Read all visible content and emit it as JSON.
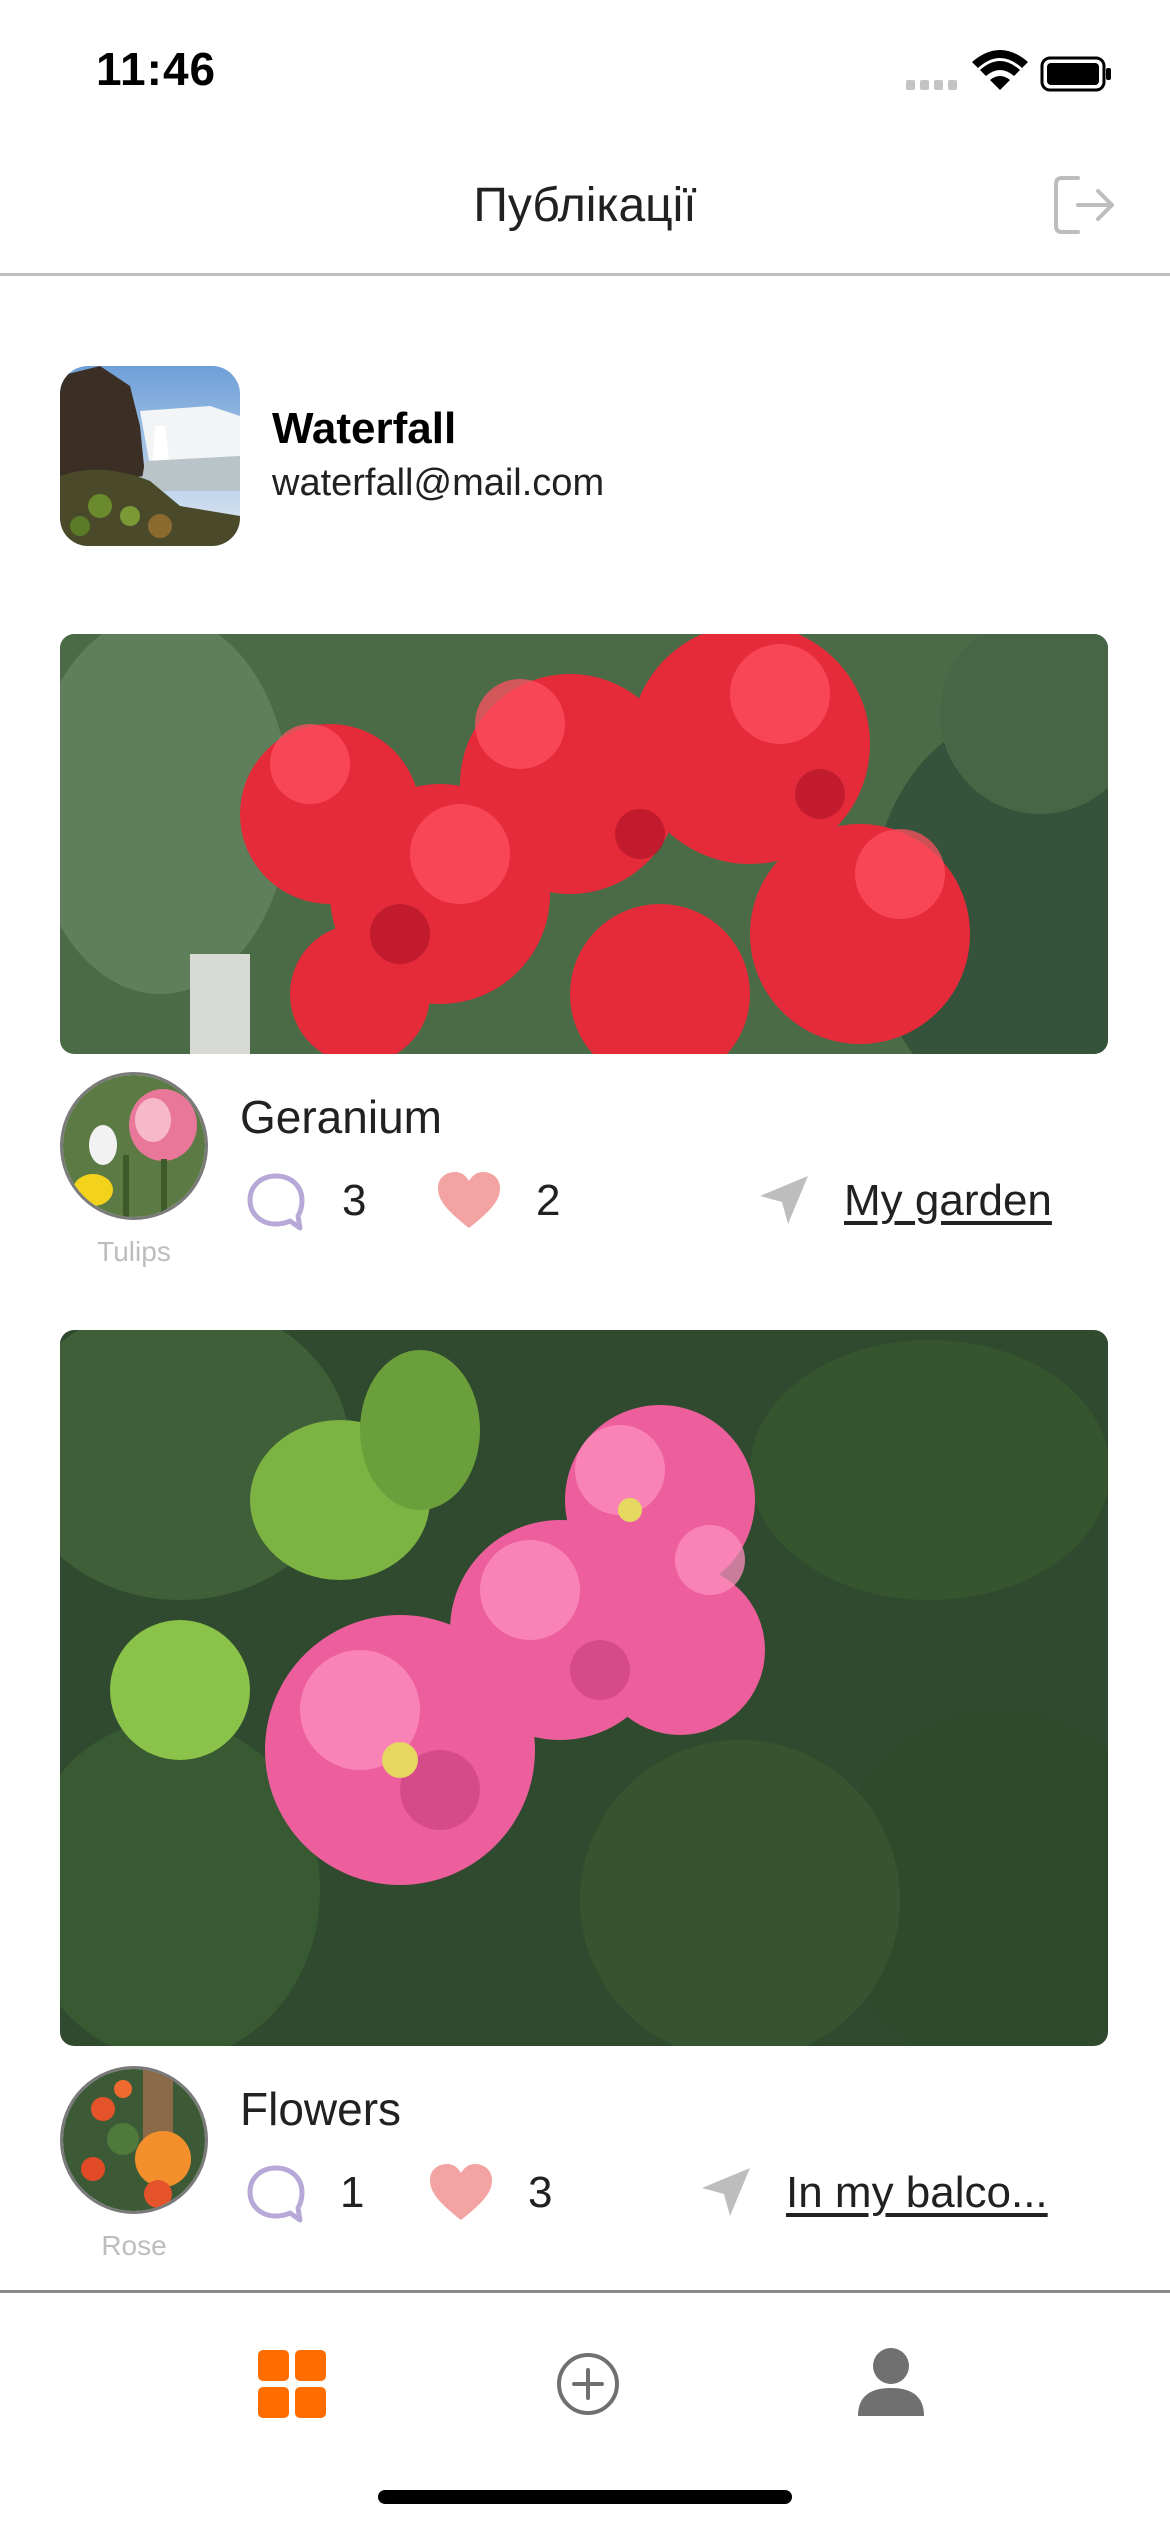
{
  "status_bar": {
    "time": "11:46"
  },
  "header": {
    "title": "Публікації"
  },
  "profile": {
    "name": "Waterfall",
    "email": "waterfall@mail.com"
  },
  "posts": [
    {
      "title": "Geranium",
      "thumb_label": "Tulips",
      "comments": "3",
      "likes": "2",
      "location": "My garden"
    },
    {
      "title": "Flowers",
      "thumb_label": "Rose",
      "comments": "1",
      "likes": "3",
      "location": "In my balco..."
    }
  ],
  "tab_bar": {
    "items": [
      "grid-icon",
      "add-circle-icon",
      "user-icon"
    ],
    "active_color": "#FF6C00",
    "inactive_color": "#707070"
  },
  "colors": {
    "accent": "#FF6C00",
    "comment_icon": "#B8A8D8",
    "heart_icon": "#F4A3A3",
    "location_icon": "#BDBDBD"
  }
}
